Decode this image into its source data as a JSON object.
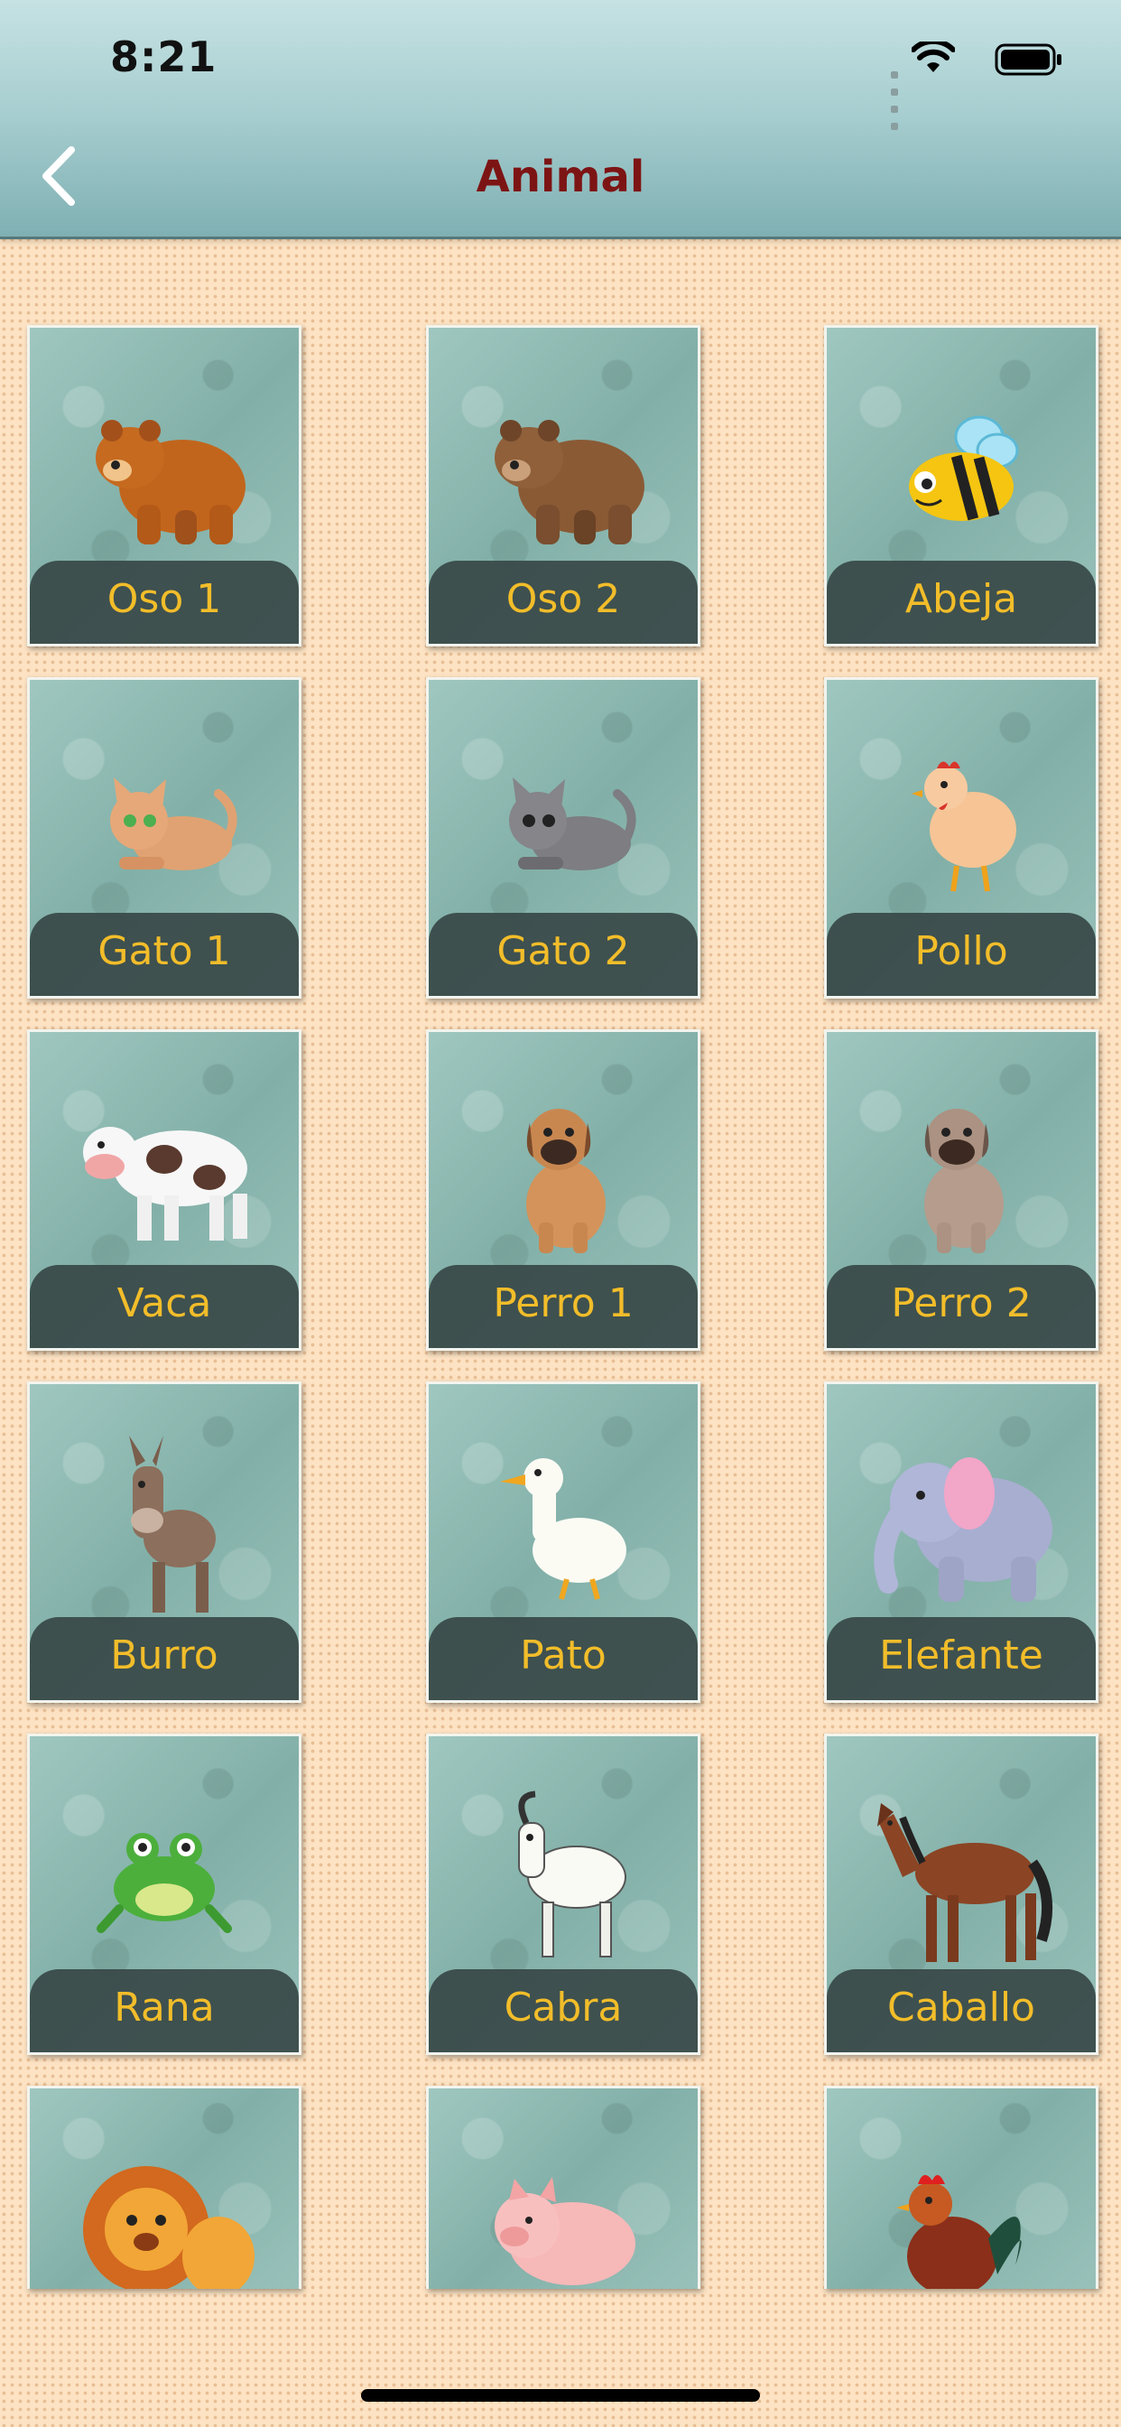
{
  "status_bar": {
    "time": "8:21"
  },
  "navbar": {
    "title": "Animal"
  },
  "colors": {
    "title": "#7d1414",
    "card_label": "#f2bd2a",
    "background": "#fde3c3"
  },
  "animals": [
    {
      "label": "Oso 1",
      "icon": "brown-bear-icon"
    },
    {
      "label": "Oso 2",
      "icon": "grizzly-bear-icon"
    },
    {
      "label": "Abeja",
      "icon": "bee-icon"
    },
    {
      "label": "Gato 1",
      "icon": "orange-cat-icon"
    },
    {
      "label": "Gato 2",
      "icon": "gray-cat-icon"
    },
    {
      "label": "Pollo",
      "icon": "chicken-icon"
    },
    {
      "label": "Vaca",
      "icon": "cow-icon"
    },
    {
      "label": "Perro 1",
      "icon": "brown-dog-icon"
    },
    {
      "label": "Perro 2",
      "icon": "gray-dog-icon"
    },
    {
      "label": "Burro",
      "icon": "donkey-icon"
    },
    {
      "label": "Pato",
      "icon": "duck-icon"
    },
    {
      "label": "Elefante",
      "icon": "elephant-icon"
    },
    {
      "label": "Rana",
      "icon": "frog-icon"
    },
    {
      "label": "Cabra",
      "icon": "goat-icon"
    },
    {
      "label": "Caballo",
      "icon": "horse-icon"
    },
    {
      "label": "",
      "icon": "lion-icon"
    },
    {
      "label": "",
      "icon": "pig-icon"
    },
    {
      "label": "",
      "icon": "rooster-icon"
    }
  ]
}
